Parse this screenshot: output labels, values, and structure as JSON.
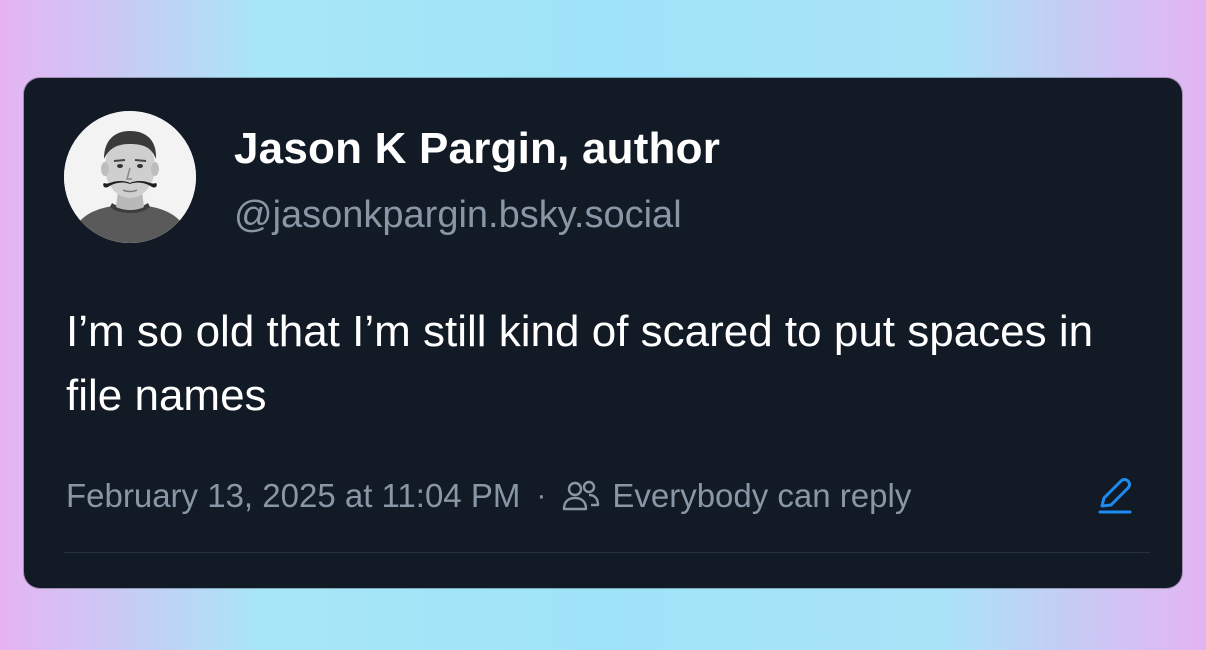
{
  "post": {
    "author": {
      "display_name": "Jason K Pargin, author",
      "handle": "@jasonkpargin.bsky.social"
    },
    "text": "I’m so old that I’m still kind of scared to put spaces in file names",
    "timestamp": "February 13, 2025 at 11:04 PM",
    "separator": "·",
    "reply_setting": "Everybody can reply"
  },
  "icons": {
    "audience": "people-icon",
    "edit": "pencil-icon"
  },
  "colors": {
    "card_background": "#111a25",
    "text_primary": "#ffffff",
    "text_muted": "#8996a5",
    "accent": "#1d8cf0"
  }
}
